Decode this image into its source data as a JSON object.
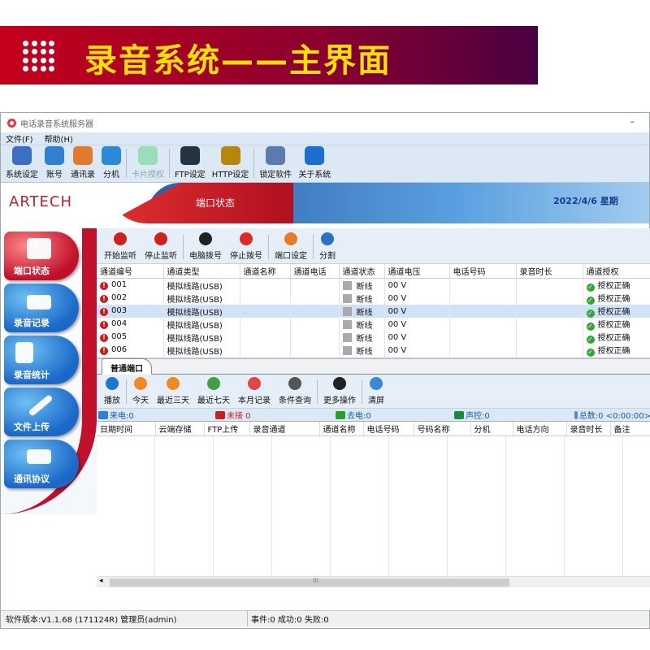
{
  "banner": {
    "title": "录音系统——主界面"
  },
  "window": {
    "title": "电话录音系统服务器",
    "minimize": "–"
  },
  "menu": [
    "文件(F)",
    "帮助(H)"
  ],
  "toolbar": [
    {
      "label": "系统设定",
      "icon": "gear-icon",
      "color": "#3b6fc2"
    },
    {
      "label": "账号",
      "icon": "user-key-icon",
      "color": "#2f80d0"
    },
    {
      "label": "通讯录",
      "icon": "address-book-icon",
      "color": "#e07a2c"
    },
    {
      "label": "分机",
      "icon": "extension-group-icon",
      "color": "#2a8ad8"
    },
    {
      "label": "卡片授权",
      "icon": "card-auth-icon",
      "color": "#9db"
    },
    {
      "label": "FTP设定",
      "icon": "ftp-icon",
      "color": "#234"
    },
    {
      "label": "HTTP设定",
      "icon": "http-icon",
      "color": "#b8860b"
    },
    {
      "label": "锁定软件",
      "icon": "lock-screen-icon",
      "color": "#5a7ab0"
    },
    {
      "label": "关于系统",
      "icon": "info-icon",
      "color": "#1a6fd0"
    }
  ],
  "header": {
    "logo": "ARTECH",
    "page_title": "端口状态",
    "date": "2022/4/6 星期"
  },
  "sidebar": [
    {
      "label": "端口状态",
      "active": true
    },
    {
      "label": "录音记录",
      "active": false
    },
    {
      "label": "录音统计",
      "active": false
    },
    {
      "label": "文件上传",
      "active": false
    },
    {
      "label": "通讯协议",
      "active": false
    }
  ],
  "port_buttons": [
    {
      "label": "开始监听",
      "color": "#d02020"
    },
    {
      "label": "停止监听",
      "color": "#d02020"
    },
    {
      "label": "电脑拨号",
      "color": "#222"
    },
    {
      "label": "停止拨号",
      "color": "#e02828"
    },
    {
      "label": "端口设定",
      "color": "#e87a20"
    },
    {
      "label": "分割",
      "color": "#2a70c8"
    }
  ],
  "port_table": {
    "columns": [
      "通道编号",
      "通道类型",
      "通道名称",
      "通道电话",
      "通道状态",
      "通道电压",
      "电话号码",
      "录音时长",
      "通道授权"
    ],
    "rows": [
      {
        "id": "001",
        "type": "模拟线路(USB)",
        "status": "断线",
        "voltage": "00 V",
        "auth": "授权正确"
      },
      {
        "id": "002",
        "type": "模拟线路(USB)",
        "status": "断线",
        "voltage": "00 V",
        "auth": "授权正确"
      },
      {
        "id": "003",
        "type": "模拟线路(USB)",
        "status": "断线",
        "voltage": "00 V",
        "auth": "授权正确"
      },
      {
        "id": "004",
        "type": "模拟线路(USB)",
        "status": "断线",
        "voltage": "00 V",
        "auth": "授权正确"
      },
      {
        "id": "005",
        "type": "模拟线路(USB)",
        "status": "断线",
        "voltage": "00 V",
        "auth": "授权正确"
      },
      {
        "id": "006",
        "type": "模拟线路(USB)",
        "status": "断线",
        "voltage": "00 V",
        "auth": "授权正确"
      }
    ],
    "selected_index": 2
  },
  "tab": {
    "label": "普通端口"
  },
  "record_buttons": [
    {
      "label": "播放",
      "color": "#1a78d0"
    },
    {
      "label": "今天",
      "color": "#f08a20"
    },
    {
      "label": "最近三天",
      "color": "#f08a20"
    },
    {
      "label": "最近七天",
      "color": "#40a040"
    },
    {
      "label": "本月记录",
      "color": "#e04848"
    },
    {
      "label": "条件查询",
      "color": "#555"
    },
    {
      "label": "更多操作",
      "color": "#222"
    },
    {
      "label": "清屏",
      "color": "#3a88d8"
    }
  ],
  "stats": {
    "incoming": "来电:0",
    "missed": "未接 0",
    "outgoing": "去电:0",
    "voice": "声控:0",
    "total": "总数:0 <0:00:00>"
  },
  "records_table": {
    "columns": [
      "日期时间",
      "云端存储",
      "FTP上传",
      "录音通道",
      "通道名称",
      "电话号码",
      "号码名称",
      "分机",
      "电话方向",
      "录音时长",
      "备注"
    ]
  },
  "scroll_marker": "III",
  "statusbar": {
    "version": "软件版本:V1.1.68 (171124R) 管理员(admin)",
    "events": "事件:0 成功:0 失败:0"
  }
}
